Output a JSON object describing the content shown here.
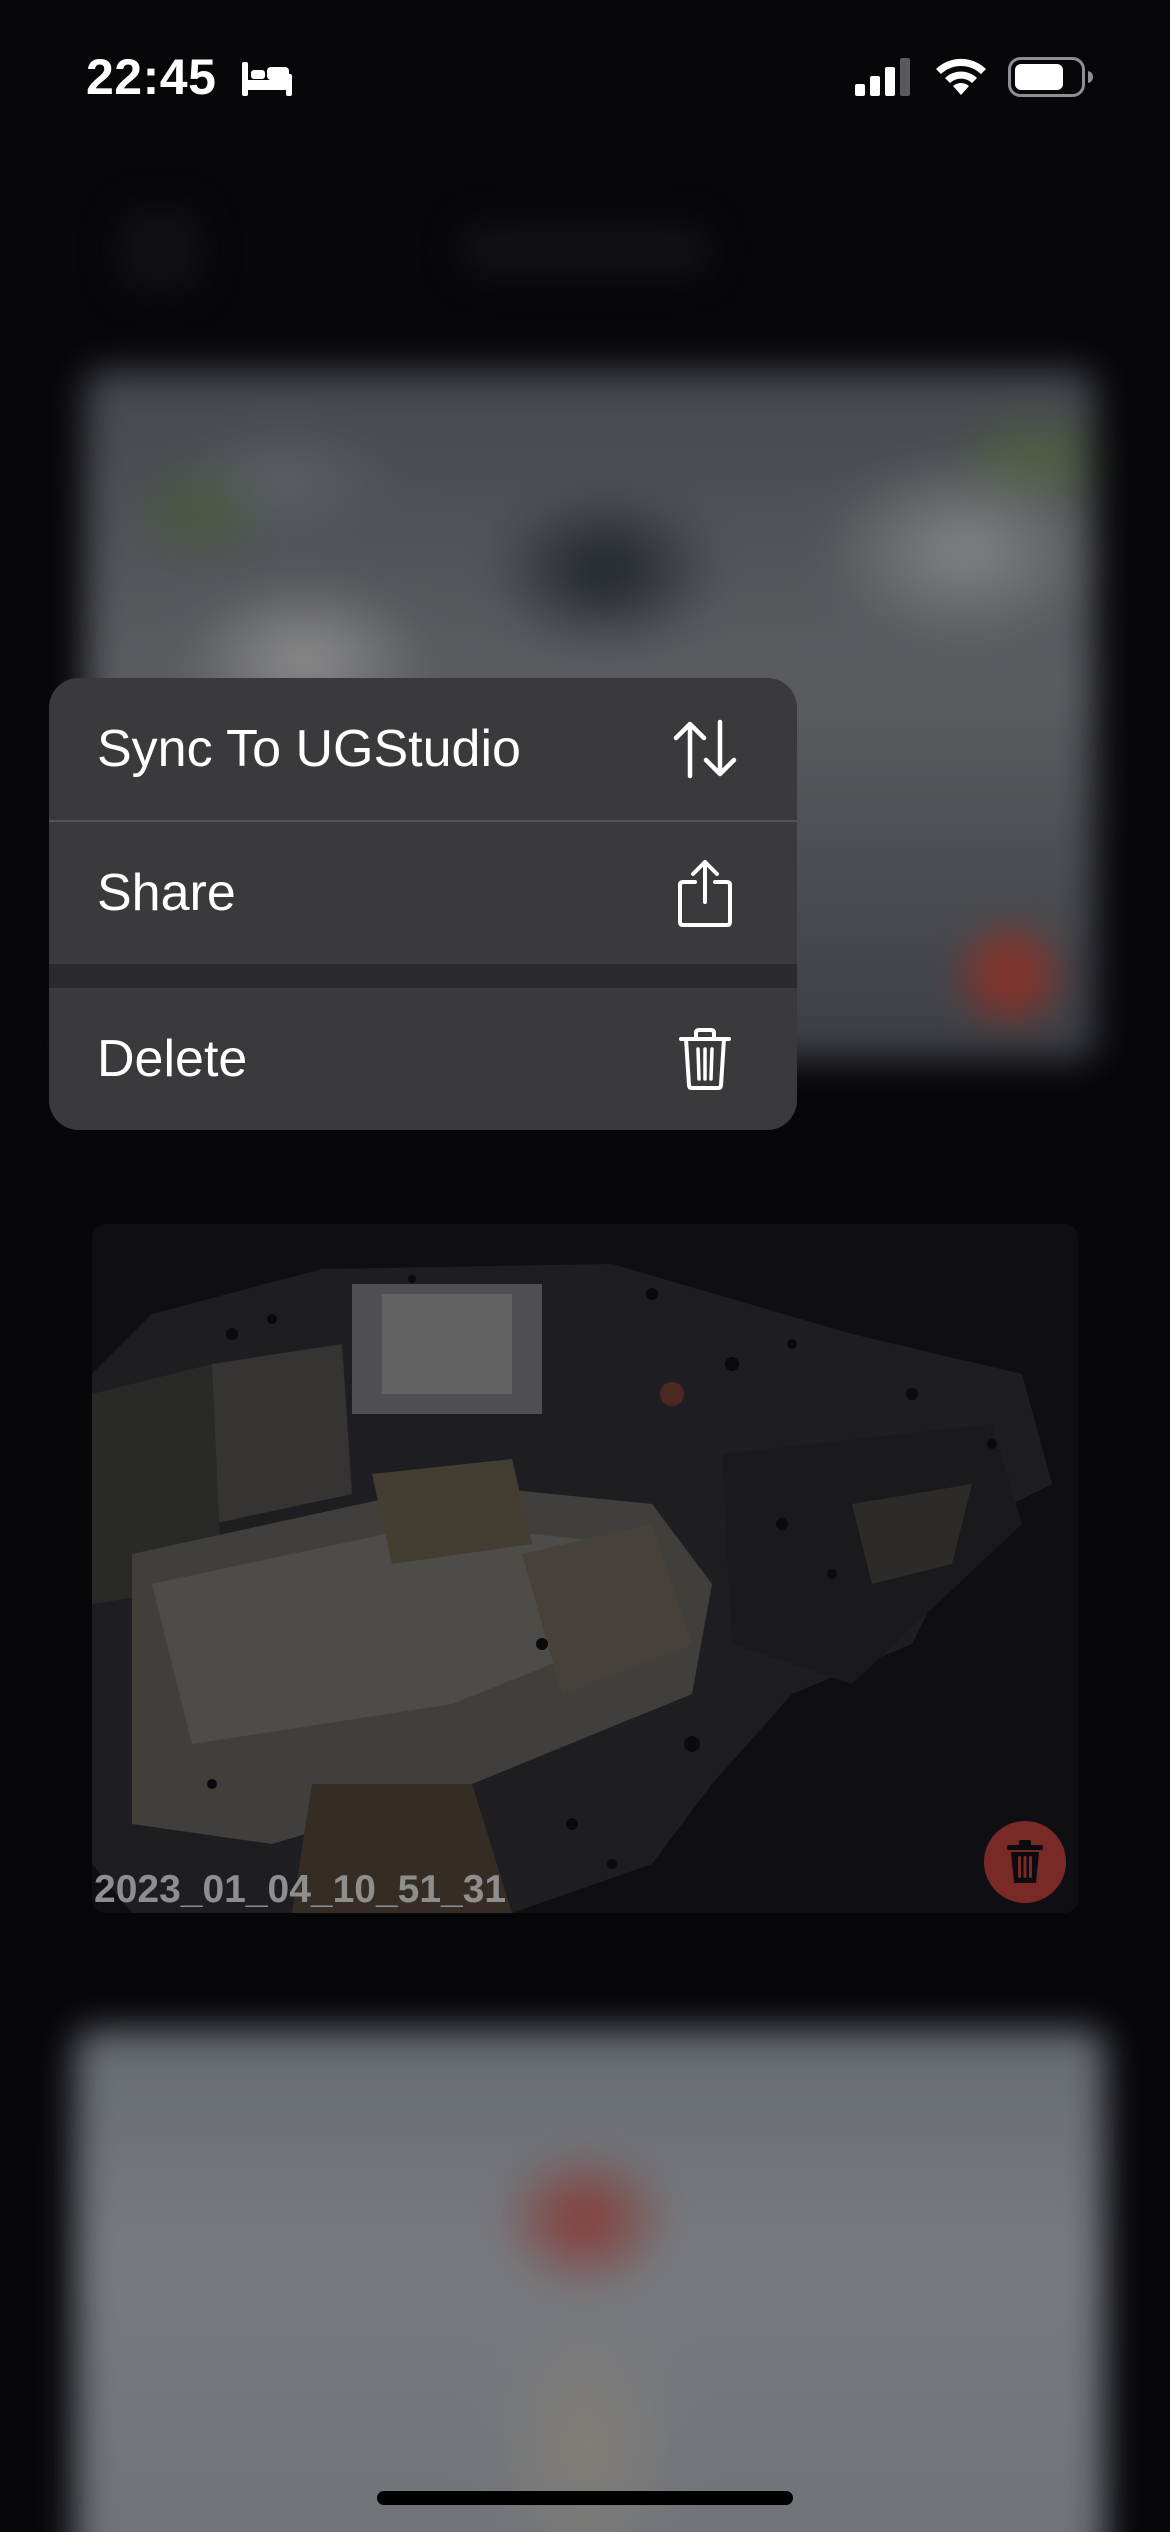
{
  "status_bar": {
    "time": "22:45",
    "focus_icon": "bed-icon",
    "signal_icon": "cellular-signal-icon",
    "wifi_icon": "wifi-icon",
    "battery_icon": "battery-icon",
    "battery_level": 0.75
  },
  "context_menu": {
    "items": [
      {
        "label": "Sync To UGStudio",
        "icon": "sync-arrows-icon"
      },
      {
        "label": "Share",
        "icon": "share-icon"
      },
      {
        "label": "Delete",
        "icon": "trash-icon"
      }
    ]
  },
  "scan": {
    "name": "2023_01_04_10_51_31",
    "delete_icon": "trash-icon"
  },
  "colors": {
    "background": "#0b0b10",
    "menu": "#3a3a3c",
    "menu_text": "#ffffff",
    "delete_badge": "#7a2a26",
    "scan_name": "#8e8e8e"
  }
}
